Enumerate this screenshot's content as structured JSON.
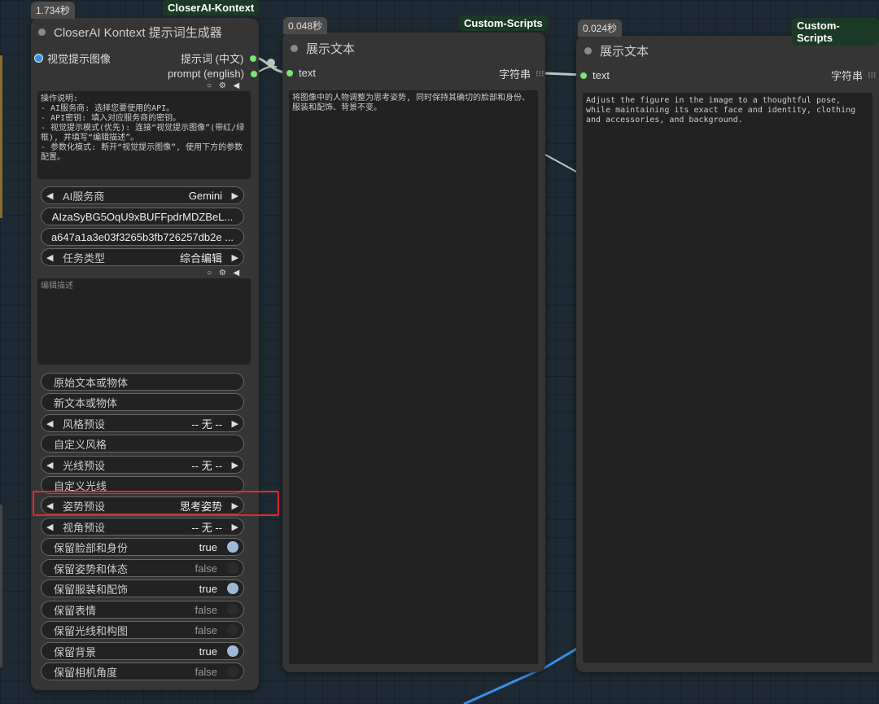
{
  "node1": {
    "time": "1.734秒",
    "badge": "CloserAI-Kontext",
    "title": "CloserAI Kontext 提示词生成器",
    "input_label": "视觉提示图像",
    "output1": "提示词 (中文)",
    "output2": "prompt (english)",
    "instructions": "操作说明:\n- AI服务商: 选择您要使用的API。\n- API密钥: 填入对应服务商的密钥。\n- 视觉提示模式(优先): 连接“视觉提示图像”(带红/绿框), 并填写“编辑描述”。\n- 参数化模式: 断开“视觉提示图像”, 使用下方的参数配置。",
    "ai_provider_label": "AI服务商",
    "ai_provider_value": "Gemini",
    "api_key1": "AIzaSyBG5OqU9xBUFFpdrMDZBeL...",
    "api_key2": "a647a1a3e03f3265b3fb726257db2e ...",
    "task_type_label": "任务类型",
    "task_type_value": "综合编辑",
    "edit_placeholder": "编辑描述",
    "original_text": "原始文本或物体",
    "new_text": "新文本或物体",
    "style_label": "风格预设",
    "style_value": "-- 无 --",
    "custom_style": "自定义风格",
    "light_label": "光线预设",
    "light_value": "-- 无 --",
    "custom_light": "自定义光线",
    "pose_label": "姿势预设",
    "pose_value": "思考姿势",
    "angle_label": "视角预设",
    "angle_value": "-- 无 --",
    "toggles": [
      {
        "label": "保留脸部和身份",
        "value": "true"
      },
      {
        "label": "保留姿势和体态",
        "value": "false"
      },
      {
        "label": "保留服装和配饰",
        "value": "true"
      },
      {
        "label": "保留表情",
        "value": "false"
      },
      {
        "label": "保留光线和构图",
        "value": "false"
      },
      {
        "label": "保留背景",
        "value": "true"
      },
      {
        "label": "保留相机角度",
        "value": "false"
      }
    ]
  },
  "node2": {
    "time": "0.048秒",
    "badge": "Custom-Scripts",
    "title": "展示文本",
    "input_label": "text",
    "output_label": "字符串",
    "text": "将图像中的人物调整为思考姿势, 同时保持其确切的脸部和身份、服装和配饰、背景不变。"
  },
  "node3": {
    "time": "0.024秒",
    "badge": "Custom-Scripts",
    "title": "展示文本",
    "input_label": "text",
    "output_label": "字符串",
    "text": "Adjust the figure in the image to a thoughtful pose, while maintaining its exact face and identity, clothing and accessories, and background."
  },
  "colors": {
    "background": "#1e2a33",
    "node": "#353535",
    "badge": "#1a3a26",
    "slot": "#7de37b",
    "highlight": "#e8272a",
    "wire_blue": "#3a8ee6"
  }
}
